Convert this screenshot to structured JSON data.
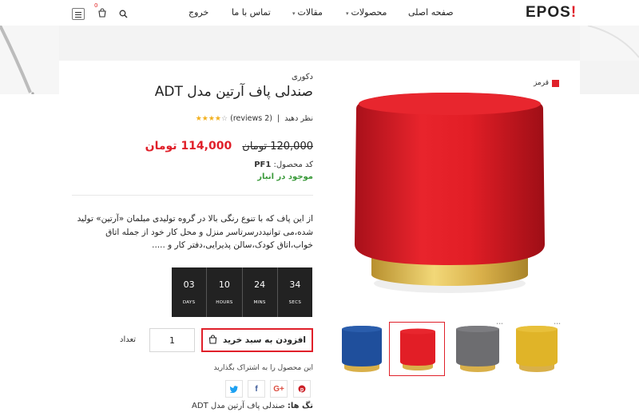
{
  "header": {
    "logo_text": "EPOS",
    "logo_mark": "!",
    "nav": [
      "صفحه اصلی",
      "محصولات",
      "مقالات",
      "تماس با ما",
      "خروج"
    ],
    "cart_count": "0",
    "icons": [
      "search-icon",
      "cart-icon",
      "menu-icon",
      "chevron-down-icon"
    ]
  },
  "product": {
    "category": "دکوری",
    "title": "ADT صندلی پاف آرتین مدل",
    "rating_stars": 4,
    "reviews_text": "(2 reviews)",
    "review_cta": "نظر دهید",
    "price_old": "120,000 تومان",
    "price_new": "114,000 تومان",
    "sku_label": "کد محصول:",
    "sku_value": "PF1",
    "stock": "موجود در انبار",
    "description": "از این پاف که با تنوع رنگی بالا در گروه تولیدی مبلمان «آرتین» تولید شده،می توانیددرسرتاسر منزل و محل کار خود از جمله اتاق خواب،اتاق کودک،سالن پذیرایی،دفتر کار و .....",
    "countdown": [
      {
        "value": "03",
        "label": "DAYS"
      },
      {
        "value": "10",
        "label": "HOURS"
      },
      {
        "value": "24",
        "label": "MINS"
      },
      {
        "value": "34",
        "label": "SECS"
      }
    ],
    "add_to_cart": "افزودن به سبد خرید",
    "quantity": "1",
    "quantity_label": "تعداد",
    "share_text": "این محصول را به اشتراک بگذارید",
    "tags_label": "تگ ها:",
    "tags_value": "صندلی پاف آرتین مدل ADT"
  },
  "gallery": {
    "selected_color": "قرمز",
    "main_color": "#e21e26",
    "thumbnails": [
      {
        "color": "#1f4f9c",
        "name": "blue"
      },
      {
        "color": "#e21e26",
        "name": "red"
      },
      {
        "color": "#6d6d70",
        "name": "gray"
      },
      {
        "color": "#e0b428",
        "name": "yellow"
      }
    ]
  },
  "colors": {
    "accent": "#e0202a",
    "in_stock": "#3a9a3a",
    "countdown_bg": "#222222",
    "gold_base": "#d9b04a"
  }
}
